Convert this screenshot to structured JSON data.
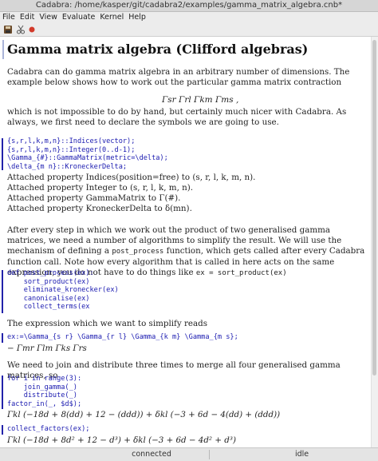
{
  "window": {
    "title": "Cadabra: /home/kasper/git/cadabra2/examples/gamma_matrix_algebra.cnb*"
  },
  "menu": [
    "File",
    "Edit",
    "View",
    "Evaluate",
    "Kernel",
    "Help"
  ],
  "toolbar": {
    "icons": [
      "save-icon",
      "cut-icon",
      "stop-icon"
    ]
  },
  "doc": {
    "heading": "Gamma matrix algebra (Clifford algebras)",
    "intro": "Cadabra can do gamma matrix algebra in an arbitrary number of dimensions. The example below shows how to work out the particular gamma matrix contraction",
    "contraction": "Γsr Γrl Γkm Γms ,",
    "intro2": "which is not impossible to do by hand, but certainly much nicer with Cadabra. As always, we first need to declare the symbols we are going to use.",
    "cell1": [
      "{s,r,l,k,m,n}::Indices(vector);",
      "{s,r,l,k,m,n}::Integer(0..d-1);",
      "\\Gamma_{#}::GammaMatrix(metric=\\delta);",
      "\\delta_{m n}::KroneckerDelta;"
    ],
    "out1": [
      "Attached property Indices(position=free) to (s, r, l, k, m, n).",
      "Attached property Integer to (s, r, l, k, m, n).",
      "Attached property GammaMatrix to Γ(#).",
      "Attached property KroneckerDelta to δ(mn)."
    ],
    "para3a": "After every step in which we work out the product of two generalised gamma matrices, we need a number of algorithms to simplify the result. We will use the mechanism of defining a",
    "para3code": "post_process",
    "para3b": "function, which gets called after every Cadabra function call. Note how every algorithm that is called in here acts on the same expression; you do not have to do things like",
    "para3code2": "ex = sort_product(ex)",
    "cell2": [
      "def post_process(ex):",
      "    sort_product(ex)",
      "    eliminate_kronecker(ex)",
      "    canonicalise(ex)",
      "    collect_terms(ex"
    ],
    "para4": "The expression which we want to simplify reads",
    "cell3": "ex:=\\Gamma_{s r} \\Gamma_{r l} \\Gamma_{k m} \\Gamma_{m s};",
    "out3": "− Γmr Γlm Γks Γrs",
    "para5": "We need to join and distribute three times to merge all four generalised gamma matrices, so",
    "cell4": [
      "for i in range(3):",
      "    join_gamma(_)",
      "    distribute(_)",
      "factor_in(_, $d$);"
    ],
    "out4": "Γkl (−18d + 8(dd) + 12 − (ddd)) + δkl (−3 + 6d − 4(dd) + (ddd))",
    "cell5": "collect_factors(ex);",
    "out5": "Γkl (−18d + 8d² + 12 − d³) + δkl (−3 + 6d − 4d² + d³)"
  },
  "status": {
    "left": "connected",
    "right": "idle"
  }
}
